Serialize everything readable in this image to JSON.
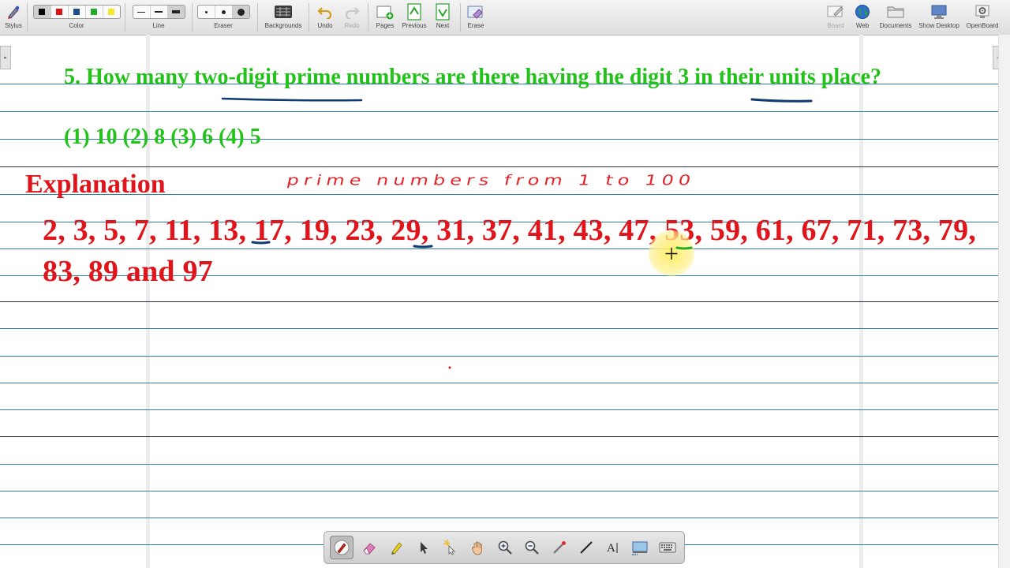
{
  "toolbar": {
    "stylus": "Stylus",
    "color": "Color",
    "line": "Line",
    "eraser": "Eraser",
    "backgrounds": "Backgrounds",
    "undo": "Undo",
    "redo": "Redo",
    "pages": "Pages",
    "previous": "Previous",
    "next": "Next",
    "erase": "Erase",
    "board": "Board",
    "web": "Web",
    "documents": "Documents",
    "show_desktop": "Show Desktop",
    "openboard": "OpenBoard"
  },
  "colors": {
    "swatches": [
      "#000000",
      "#e01010",
      "#1d4f8f",
      "#1fae2a",
      "#f4e628"
    ],
    "question_green": "#22c21b",
    "explanation_red": "#e0141b",
    "underline_ink": "#0e3a6e"
  },
  "question": {
    "text": "5. How many two-digit prime numbers are there having the digit 3 in their units place?",
    "options": "(1) 10 (2) 8 (3) 6 (4) 5"
  },
  "explanation": {
    "heading": "Explanation",
    "handwritten_note": "prime numbers from 1 to 100",
    "primes": "2, 3, 5, 7, 11, 13, 17, 19, 23, 29, 31, 37, 41, 43, 47, 53, 59, 61, 67, 71, 73, 79, 83, 89 and 97"
  },
  "edges": {
    "left_arrow": "▸",
    "right_arrow": "◂"
  },
  "palette": {
    "tools": [
      "pen-icon",
      "eraser-icon",
      "highlighter-icon",
      "pointer-icon",
      "laser-icon",
      "hand-icon",
      "zoom-in-icon",
      "zoom-out-icon",
      "capture-icon",
      "line-icon",
      "text-icon",
      "screen-capture-icon",
      "keyboard-icon"
    ],
    "text_tool": "A"
  }
}
